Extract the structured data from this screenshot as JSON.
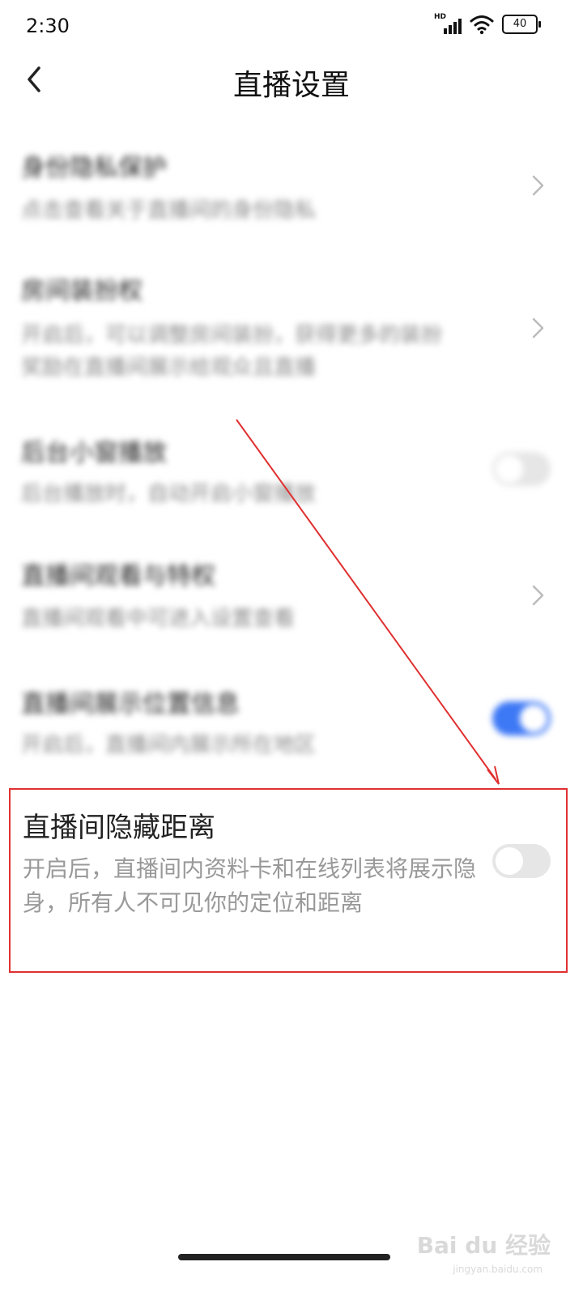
{
  "status_bar": {
    "time": "2:30",
    "network_label": "HD",
    "battery": "40",
    "icons": [
      "hd-signal-icon",
      "wifi-icon",
      "battery-icon"
    ]
  },
  "header": {
    "title": "直播设置",
    "back_icon": "chevron-left-icon"
  },
  "settings": [
    {
      "title": "身份隐私保护",
      "desc": "点击查看关于直播间的身份隐私",
      "control": "chevron"
    },
    {
      "title": "房间装扮权",
      "desc": "开启后，可以调整房间装扮，获得更多的装扮奖励在直播间展示给观众且直播",
      "control": "chevron"
    },
    {
      "title": "后台小窗播放",
      "desc": "后台播放时，自动开启小窗播放",
      "control": "toggle",
      "on": false
    },
    {
      "title": "直播间观看与特权",
      "desc": "直播间观看中可进入设置查看",
      "control": "chevron"
    },
    {
      "title": "直播间展示位置信息",
      "desc": "开启后，直播间内展示所在地区",
      "control": "toggle",
      "on": true
    }
  ],
  "highlighted": {
    "title": "直播间隐藏距离",
    "desc": "开启后，直播间内资料卡和在线列表将展示隐身，所有人不可见你的定位和距离",
    "toggle_on": false
  },
  "watermark": {
    "brand": "Bai du 经验",
    "url": "jingyan.baidu.com"
  },
  "colors": {
    "accent": "#3d78f5",
    "annotation": "#e03030",
    "toggle_off": "#e6e6e6"
  }
}
